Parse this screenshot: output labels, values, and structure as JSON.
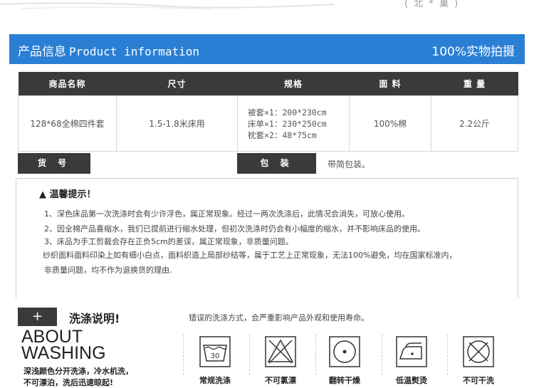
{
  "brand": "( 北 * 巢 )",
  "banner": {
    "title_cn": "产品信息",
    "title_en": "Product information",
    "right": "100%实物拍摄"
  },
  "table": {
    "headers": [
      "商品名称",
      "尺寸",
      "规格",
      "面 料",
      "重 量"
    ],
    "row": {
      "name": "128*68全棉四件套",
      "size": "1.5-1.8米床用",
      "specs": [
        "被套×1：200*230cm",
        "床单×1：230*250cm",
        "枕套×2：48*75cm"
      ],
      "fabric": "100%棉",
      "weight": "2.2公斤"
    },
    "item_no_label": "货 号",
    "pack_label": "包 装",
    "pack_value": "带简包装。"
  },
  "tips": {
    "title": "▲ 温馨提示！",
    "lines": [
      "1、深色床品第一次洗涤时会有少许浮色，属正常现象。经过一两次洗涤后，此情况会消失，可放心使用。",
      "2、因全棉产品喜缩水，我们已提前进行缩水处理，但初次洗涤时仍会有小幅度的缩水，并不影响床品的使用。",
      "3、床品为手工剪裁会存在正负5cm的差误，属正常现象，非质量问题。",
      "纱织面料面料印染上如有细小白点，面料织造上局部纱结等，属于工艺上正常现象，无法100%避免，均在国家标准内，",
      "非质量问题，均不作为退换货的理由."
    ]
  },
  "washing": {
    "plus": "+",
    "title": "洗涤说明!",
    "about_line1": "ABOUT",
    "about_line2": "WASHING",
    "notes": [
      "深浅颜色分开洗涤，冷水机洗，",
      "不可漂泊，洗后迅速晾起!"
    ],
    "wrong": "错误的洗涤方式，会严重影响产品外观和使用寿命。",
    "tub_number": "30",
    "icons": [
      {
        "icon": "wash-tub-icon",
        "label": "常规洗涤"
      },
      {
        "icon": "no-bleach-icon",
        "label": "不可氯漂"
      },
      {
        "icon": "tumble-dry-icon",
        "label": "翻转干燥"
      },
      {
        "icon": "iron-low-icon",
        "label": "低温熨烫"
      },
      {
        "icon": "no-dry-clean-icon",
        "label": "不可干洗"
      }
    ]
  }
}
